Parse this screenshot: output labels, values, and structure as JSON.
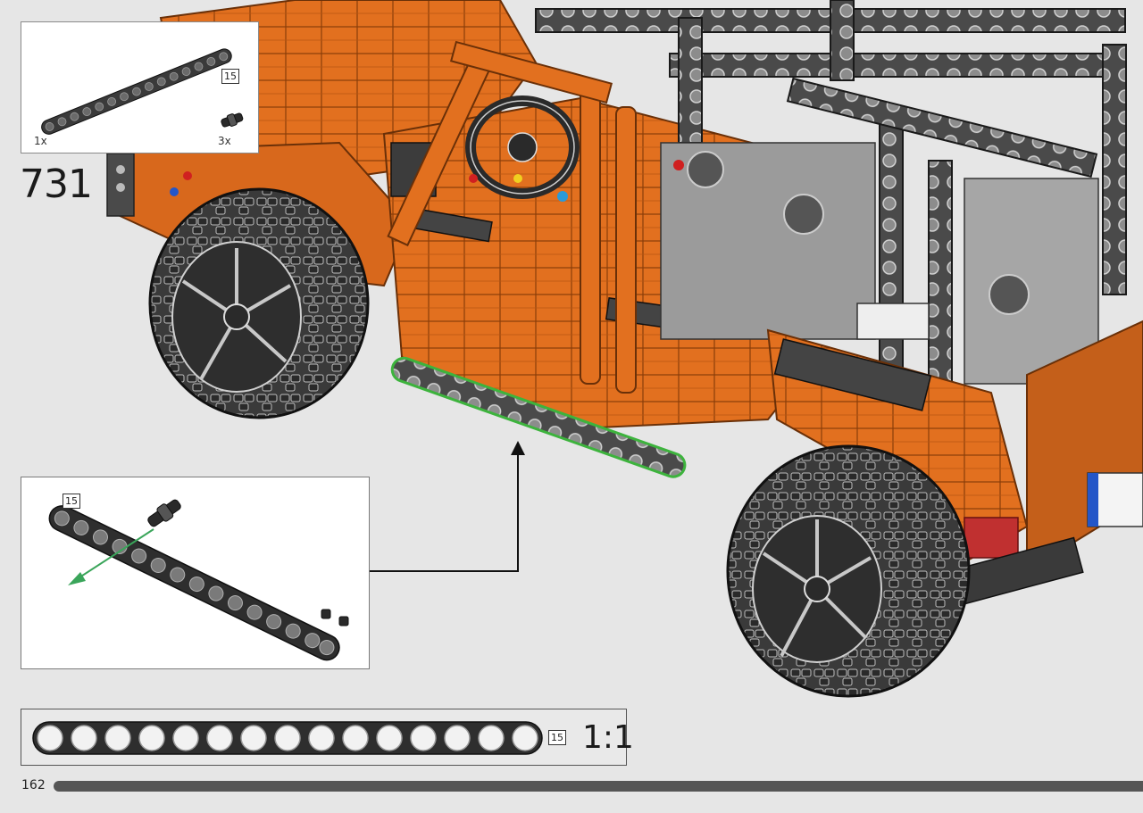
{
  "step": {
    "number": "731"
  },
  "parts_list": {
    "items": [
      {
        "name": "beam-15",
        "quantity": "1x",
        "length": "15"
      },
      {
        "name": "axle-pin-connector",
        "quantity": "3x"
      }
    ]
  },
  "callout": {
    "length_badge": "15"
  },
  "scale_indicator": {
    "length_badge": "15",
    "label": "1:1"
  },
  "footer": {
    "page_number": "162",
    "progress_fraction": 1.0
  },
  "colors": {
    "model_orange": "#e2701f",
    "model_dark_grey": "#4a4a4a",
    "model_light_grey": "#a9a9a9",
    "highlight_green": "#3db33d",
    "arrow_green": "#3aa55a",
    "background": "#e6e6e6"
  },
  "icons": {
    "callout_arrow": "arrow-up-icon"
  }
}
